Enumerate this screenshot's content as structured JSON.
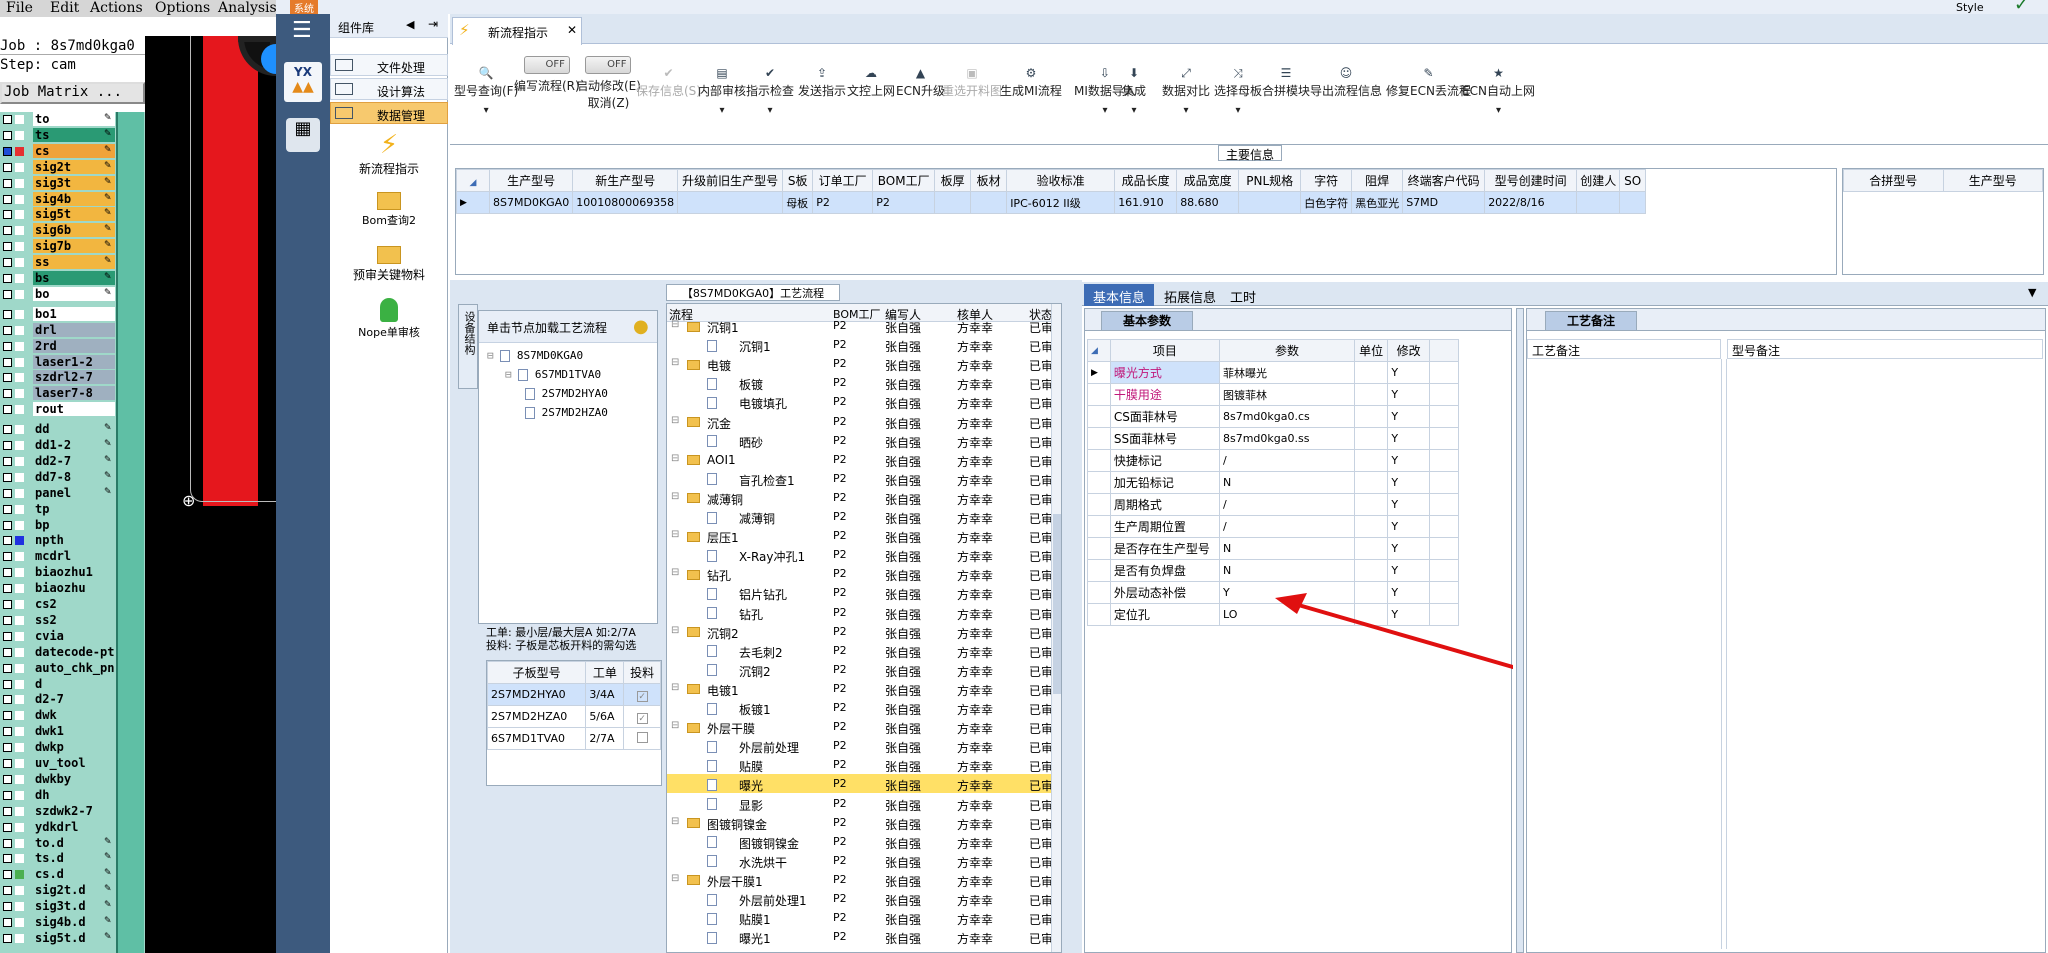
{
  "cam": {
    "menu": [
      "File",
      "Edit",
      "Actions",
      "Options",
      "Analysis"
    ],
    "job": "Job : 8s7md0kga0",
    "step": "Step: cam",
    "matrix_btn": "Job Matrix ...",
    "layers": [
      {
        "n": "to",
        "c": "#ffffff",
        "bg": "#ffffff",
        "p": true
      },
      {
        "n": "ts",
        "c": "#ffffff",
        "bg": "#2a9a74",
        "p": true
      },
      {
        "n": "cs",
        "c": "#e53030",
        "bg": "#f0a33a",
        "p": true,
        "sel": true
      },
      {
        "n": "sig2t",
        "c": "#ffffff",
        "bg": "#f2b640",
        "p": true
      },
      {
        "n": "sig3t",
        "c": "#ffffff",
        "bg": "#f2b640",
        "p": true
      },
      {
        "n": "sig4b",
        "c": "#ffffff",
        "bg": "#f2b640",
        "p": true
      },
      {
        "n": "sig5t",
        "c": "#ffffff",
        "bg": "#f2b640",
        "p": true
      },
      {
        "n": "sig6b",
        "c": "#ffffff",
        "bg": "#f2b640",
        "p": true
      },
      {
        "n": "sig7b",
        "c": "#ffffff",
        "bg": "#f2b640",
        "p": true
      },
      {
        "n": "ss",
        "c": "#ffffff",
        "bg": "#f2b640",
        "p": true
      },
      {
        "n": "bs",
        "c": "#ffffff",
        "bg": "#2a9a74",
        "p": true
      },
      {
        "n": "bo",
        "c": "#ffffff",
        "bg": "#ffffff",
        "p": true
      },
      {
        "n": "bo1",
        "c": "#ffffff",
        "bg": "#ffffff",
        "p": false
      },
      {
        "n": "drl",
        "c": "#ffffff",
        "bg": "#9fb0c0",
        "p": false
      },
      {
        "n": "2rd",
        "c": "#ffffff",
        "bg": "#9fb0c0",
        "p": false
      },
      {
        "n": "laser1-2",
        "c": "#ffffff",
        "bg": "#9fb0c0",
        "p": false
      },
      {
        "n": "szdrl2-7",
        "c": "#ffffff",
        "bg": "#9fb0c0",
        "p": false
      },
      {
        "n": "laser7-8",
        "c": "#ffffff",
        "bg": "#9fb0c0",
        "p": false
      },
      {
        "n": "rout",
        "c": "#ffffff",
        "bg": "#ffffff",
        "p": false
      },
      {
        "n": "dd",
        "c": "#ffffff",
        "bg": "#9fd8c9",
        "p": true
      },
      {
        "n": "dd1-2",
        "c": "#ffffff",
        "bg": "#9fd8c9",
        "p": true
      },
      {
        "n": "dd2-7",
        "c": "#ffffff",
        "bg": "#9fd8c9",
        "p": true
      },
      {
        "n": "dd7-8",
        "c": "#ffffff",
        "bg": "#9fd8c9",
        "p": true
      },
      {
        "n": "panel",
        "c": "#ffffff",
        "bg": "#9fd8c9",
        "p": true
      },
      {
        "n": "tp",
        "c": "#ffffff",
        "bg": "#9fd8c9",
        "p": false
      },
      {
        "n": "bp",
        "c": "#ffffff",
        "bg": "#9fd8c9",
        "p": false
      },
      {
        "n": "npth",
        "c": "#2030e0",
        "bg": "#9fd8c9",
        "p": false
      },
      {
        "n": "mcdrl",
        "c": "#ffffff",
        "bg": "#9fd8c9",
        "p": false
      },
      {
        "n": "biaozhu1",
        "c": "#ffffff",
        "bg": "#9fd8c9",
        "p": false
      },
      {
        "n": "biaozhu",
        "c": "#ffffff",
        "bg": "#9fd8c9",
        "p": false
      },
      {
        "n": "cs2",
        "c": "#ffffff",
        "bg": "#9fd8c9",
        "p": false
      },
      {
        "n": "ss2",
        "c": "#ffffff",
        "bg": "#9fd8c9",
        "p": false
      },
      {
        "n": "cvia",
        "c": "#ffffff",
        "bg": "#9fd8c9",
        "p": false
      },
      {
        "n": "datecode-pt",
        "c": "#ffffff",
        "bg": "#9fd8c9",
        "p": false
      },
      {
        "n": "auto_chk_pn",
        "c": "#ffffff",
        "bg": "#9fd8c9",
        "p": false
      },
      {
        "n": "d",
        "c": "#ffffff",
        "bg": "#9fd8c9",
        "p": false
      },
      {
        "n": "d2-7",
        "c": "#ffffff",
        "bg": "#9fd8c9",
        "p": false
      },
      {
        "n": "dwk",
        "c": "#ffffff",
        "bg": "#9fd8c9",
        "p": false
      },
      {
        "n": "dwk1",
        "c": "#ffffff",
        "bg": "#9fd8c9",
        "p": false
      },
      {
        "n": "dwkp",
        "c": "#ffffff",
        "bg": "#9fd8c9",
        "p": false
      },
      {
        "n": "uv_tool",
        "c": "#ffffff",
        "bg": "#9fd8c9",
        "p": false
      },
      {
        "n": "dwkby",
        "c": "#ffffff",
        "bg": "#9fd8c9",
        "p": false
      },
      {
        "n": "dh",
        "c": "#ffffff",
        "bg": "#9fd8c9",
        "p": false
      },
      {
        "n": "szdwk2-7",
        "c": "#ffffff",
        "bg": "#9fd8c9",
        "p": false
      },
      {
        "n": "ydkdrl",
        "c": "#ffffff",
        "bg": "#9fd8c9",
        "p": false
      },
      {
        "n": "to.d",
        "c": "#ffffff",
        "bg": "#9fd8c9",
        "p": true
      },
      {
        "n": "ts.d",
        "c": "#ffffff",
        "bg": "#9fd8c9",
        "p": true
      },
      {
        "n": "cs.d",
        "c": "#4caf50",
        "bg": "#9fd8c9",
        "p": true
      },
      {
        "n": "sig2t.d",
        "c": "#ffffff",
        "bg": "#9fd8c9",
        "p": true
      },
      {
        "n": "sig3t.d",
        "c": "#ffffff",
        "bg": "#9fd8c9",
        "p": true
      },
      {
        "n": "sig4b.d",
        "c": "#ffffff",
        "bg": "#9fd8c9",
        "p": true
      },
      {
        "n": "sig5t.d",
        "c": "#ffffff",
        "bg": "#9fd8c9",
        "p": true
      }
    ]
  },
  "sys": {
    "label": "系统",
    "style": "Style"
  },
  "lib": {
    "title": "组件库",
    "items": [
      "文件处理",
      "设计算法",
      "数据管理"
    ],
    "tools": [
      "新流程指示",
      "Bom查询2",
      "预审关键物料",
      "Nope单审核"
    ]
  },
  "doc": {
    "tab": "新流程指示",
    "toolbar": [
      {
        "l": "型号查询(F)",
        "i": "search-icon",
        "d": false,
        "dd": true
      },
      {
        "l": "编写流程(R)",
        "i": "toggle",
        "d": false,
        "dd": false
      },
      {
        "l": "启动修改(E)",
        "l2": "取消(Z)",
        "i": "toggle",
        "d": false,
        "dd": false
      },
      {
        "l": "保存信息(S)",
        "i": "check-icon",
        "d": true,
        "dd": false
      },
      {
        "l": "内部审核",
        "i": "printer-icon",
        "d": false,
        "dd": true
      },
      {
        "l": "指示检查",
        "i": "check-icon",
        "d": false,
        "dd": true
      },
      {
        "l": "发送指示",
        "i": "upload-icon",
        "d": false,
        "dd": false
      },
      {
        "l": "文控上网",
        "i": "cloud-icon",
        "d": false,
        "dd": false
      },
      {
        "l": "ECN升级",
        "i": "car-icon",
        "d": false,
        "dd": false
      },
      {
        "l": "重选开料图",
        "i": "image-icon",
        "d": true,
        "dd": false
      },
      {
        "l": "生成MI流程",
        "i": "gears-icon",
        "d": false,
        "dd": false
      },
      {
        "l": "MI数据导入",
        "i": "import-icon",
        "d": false,
        "dd": true
      },
      {
        "l": "集成",
        "i": "download-icon",
        "d": false,
        "dd": true
      },
      {
        "l": "数据对比",
        "i": "compare-icon",
        "d": false,
        "dd": true
      },
      {
        "l": "选择母板",
        "i": "shuffle-icon",
        "d": false,
        "dd": true
      },
      {
        "l": "合拼模块",
        "i": "list-icon",
        "d": false,
        "dd": false
      },
      {
        "l": "导出流程信息",
        "i": "smile-icon",
        "d": false,
        "dd": false
      },
      {
        "l": "修复ECN丢流程",
        "i": "wrench-icon",
        "d": false,
        "dd": false
      },
      {
        "l": "ECN自动上网",
        "i": "star-icon",
        "d": false,
        "dd": true
      }
    ],
    "off": "OFF",
    "main_info": "主要信息",
    "main_cols": [
      "生产型号",
      "新生产型号",
      "升级前旧生产型号",
      "S板",
      "订单工厂",
      "BOM工厂",
      "板厚",
      "板材",
      "验收标准",
      "成品长度",
      "成品宽度",
      "PNL规格",
      "字符",
      "阻焊",
      "终端客户代码",
      "型号创建时间",
      "创建人",
      "SO"
    ],
    "main_row": [
      "8S7MD0KGA0",
      "10010800069358",
      "",
      "母板",
      "P2",
      "P2",
      "",
      "",
      "IPC-6012 II级",
      "161.910",
      "88.680",
      "",
      "白色字符",
      "黑色亚光",
      "S7MD",
      "2022/8/16",
      "",
      ""
    ],
    "merge_cols": [
      "合拼型号",
      "生产型号"
    ],
    "tree_panel_tab": "设备结构",
    "tree_hint": "单击节点加载工艺流程",
    "tree": [
      "8S7MD0KGA0",
      "6S7MD1TVA0",
      "2S7MD2HYA0",
      "2S7MD2HZA0"
    ],
    "tree_note1": "工单: 最小层/最大层A 如:2/7A",
    "tree_note2": "投料: 子板是芯板开料的需勾选",
    "sub_cols": [
      "子板型号",
      "工单",
      "投料"
    ],
    "sub_rows": [
      [
        "2S7MD2HYA0",
        "3/4A"
      ],
      [
        "2S7MD2HZA0",
        "5/6A"
      ],
      [
        "6S7MD1TVA0",
        "2/7A"
      ]
    ],
    "flow_title": "【8S7MD0KGA0】工艺流程",
    "flow_cols": [
      "流程",
      "BOM工厂",
      "编写人",
      "核单人",
      "状态"
    ],
    "flow_rows": [
      {
        "t": "沉铜1",
        "lv": 0,
        "f": "P2",
        "w": "张自强",
        "c": "方幸幸",
        "s": "已审"
      },
      {
        "t": "沉铜1",
        "lv": 1,
        "f": "P2",
        "w": "张自强",
        "c": "方幸幸",
        "s": "已审"
      },
      {
        "t": "电镀",
        "lv": 0,
        "f": "P2",
        "w": "张自强",
        "c": "方幸幸",
        "s": "已审"
      },
      {
        "t": "板镀",
        "lv": 1,
        "f": "P2",
        "w": "张自强",
        "c": "方幸幸",
        "s": "已审"
      },
      {
        "t": "电镀填孔",
        "lv": 1,
        "f": "P2",
        "w": "张自强",
        "c": "方幸幸",
        "s": "已审"
      },
      {
        "t": "沉金",
        "lv": 0,
        "f": "P2",
        "w": "张自强",
        "c": "方幸幸",
        "s": "已审"
      },
      {
        "t": "晒砂",
        "lv": 1,
        "f": "P2",
        "w": "张自强",
        "c": "方幸幸",
        "s": "已审"
      },
      {
        "t": "AOI1",
        "lv": 0,
        "f": "P2",
        "w": "张自强",
        "c": "方幸幸",
        "s": "已审"
      },
      {
        "t": "盲孔检查1",
        "lv": 1,
        "f": "P2",
        "w": "张自强",
        "c": "方幸幸",
        "s": "已审"
      },
      {
        "t": "减薄铜",
        "lv": 0,
        "f": "P2",
        "w": "张自强",
        "c": "方幸幸",
        "s": "已审"
      },
      {
        "t": "减薄铜",
        "lv": 1,
        "f": "P2",
        "w": "张自强",
        "c": "方幸幸",
        "s": "已审"
      },
      {
        "t": "层压1",
        "lv": 0,
        "f": "P2",
        "w": "张自强",
        "c": "方幸幸",
        "s": "已审"
      },
      {
        "t": "X-Ray冲孔1",
        "lv": 1,
        "f": "P2",
        "w": "张自强",
        "c": "方幸幸",
        "s": "已审"
      },
      {
        "t": "钻孔",
        "lv": 0,
        "f": "P2",
        "w": "张自强",
        "c": "方幸幸",
        "s": "已审"
      },
      {
        "t": "铝片钻孔",
        "lv": 1,
        "f": "P2",
        "w": "张自强",
        "c": "方幸幸",
        "s": "已审"
      },
      {
        "t": "钻孔",
        "lv": 1,
        "f": "P2",
        "w": "张自强",
        "c": "方幸幸",
        "s": "已审"
      },
      {
        "t": "沉铜2",
        "lv": 0,
        "f": "P2",
        "w": "张自强",
        "c": "方幸幸",
        "s": "已审"
      },
      {
        "t": "去毛刺2",
        "lv": 1,
        "f": "P2",
        "w": "张自强",
        "c": "方幸幸",
        "s": "已审"
      },
      {
        "t": "沉铜2",
        "lv": 1,
        "f": "P2",
        "w": "张自强",
        "c": "方幸幸",
        "s": "已审"
      },
      {
        "t": "电镀1",
        "lv": 0,
        "f": "P2",
        "w": "张自强",
        "c": "方幸幸",
        "s": "已审"
      },
      {
        "t": "板镀1",
        "lv": 1,
        "f": "P2",
        "w": "张自强",
        "c": "方幸幸",
        "s": "已审"
      },
      {
        "t": "外层干膜",
        "lv": 0,
        "f": "P2",
        "w": "张自强",
        "c": "方幸幸",
        "s": "已审"
      },
      {
        "t": "外层前处理",
        "lv": 1,
        "f": "P2",
        "w": "张自强",
        "c": "方幸幸",
        "s": "已审"
      },
      {
        "t": "贴膜",
        "lv": 1,
        "f": "P2",
        "w": "张自强",
        "c": "方幸幸",
        "s": "已审"
      },
      {
        "t": "曝光",
        "lv": 1,
        "f": "P2",
        "w": "张自强",
        "c": "方幸幸",
        "s": "已审",
        "hl": true
      },
      {
        "t": "显影",
        "lv": 1,
        "f": "P2",
        "w": "张自强",
        "c": "方幸幸",
        "s": "已审"
      },
      {
        "t": "图镀铜镍金",
        "lv": 0,
        "f": "P2",
        "w": "张自强",
        "c": "方幸幸",
        "s": "已审"
      },
      {
        "t": "图镀铜镍金",
        "lv": 1,
        "f": "P2",
        "w": "张自强",
        "c": "方幸幸",
        "s": "已审"
      },
      {
        "t": "水洗烘干",
        "lv": 1,
        "f": "P2",
        "w": "张自强",
        "c": "方幸幸",
        "s": "已审"
      },
      {
        "t": "外层干膜1",
        "lv": 0,
        "f": "P2",
        "w": "张自强",
        "c": "方幸幸",
        "s": "已审"
      },
      {
        "t": "外层前处理1",
        "lv": 1,
        "f": "P2",
        "w": "张自强",
        "c": "方幸幸",
        "s": "已审"
      },
      {
        "t": "贴膜1",
        "lv": 1,
        "f": "P2",
        "w": "张自强",
        "c": "方幸幸",
        "s": "已审"
      },
      {
        "t": "曝光1",
        "lv": 1,
        "f": "P2",
        "w": "张自强",
        "c": "方幸幸",
        "s": "已审"
      }
    ],
    "right_tabs": [
      "基本信息",
      "拓展信息",
      "工时"
    ],
    "basic_title": "基本参数",
    "param_cols": [
      "项目",
      "参数",
      "单位",
      "修改"
    ],
    "params": [
      {
        "k": "曝光方式",
        "v": "菲林曝光",
        "m": "Y",
        "col": "#c0177a"
      },
      {
        "k": "干膜用途",
        "v": "图镀菲林",
        "m": "Y",
        "col": "#c0177a"
      },
      {
        "k": "CS面菲林号",
        "v": "8s7md0kga0.cs",
        "m": "Y"
      },
      {
        "k": "SS面菲林号",
        "v": "8s7md0kga0.ss",
        "m": "Y"
      },
      {
        "k": "快捷标记",
        "v": "/",
        "m": "Y"
      },
      {
        "k": "加无铅标记",
        "v": "N",
        "m": "Y"
      },
      {
        "k": "周期格式",
        "v": "/",
        "m": "Y"
      },
      {
        "k": "生产周期位置",
        "v": "/",
        "m": "Y"
      },
      {
        "k": "是否存在生产型号",
        "v": "N",
        "m": "Y"
      },
      {
        "k": "是否有负焊盘",
        "v": "N",
        "m": "Y"
      },
      {
        "k": "外层动态补偿",
        "v": "Y",
        "m": "Y"
      },
      {
        "k": "定位孔",
        "v": "LO",
        "m": "Y"
      }
    ],
    "craft_title": "工艺备注",
    "craft_cols": [
      "工艺备注",
      "型号备注"
    ]
  }
}
